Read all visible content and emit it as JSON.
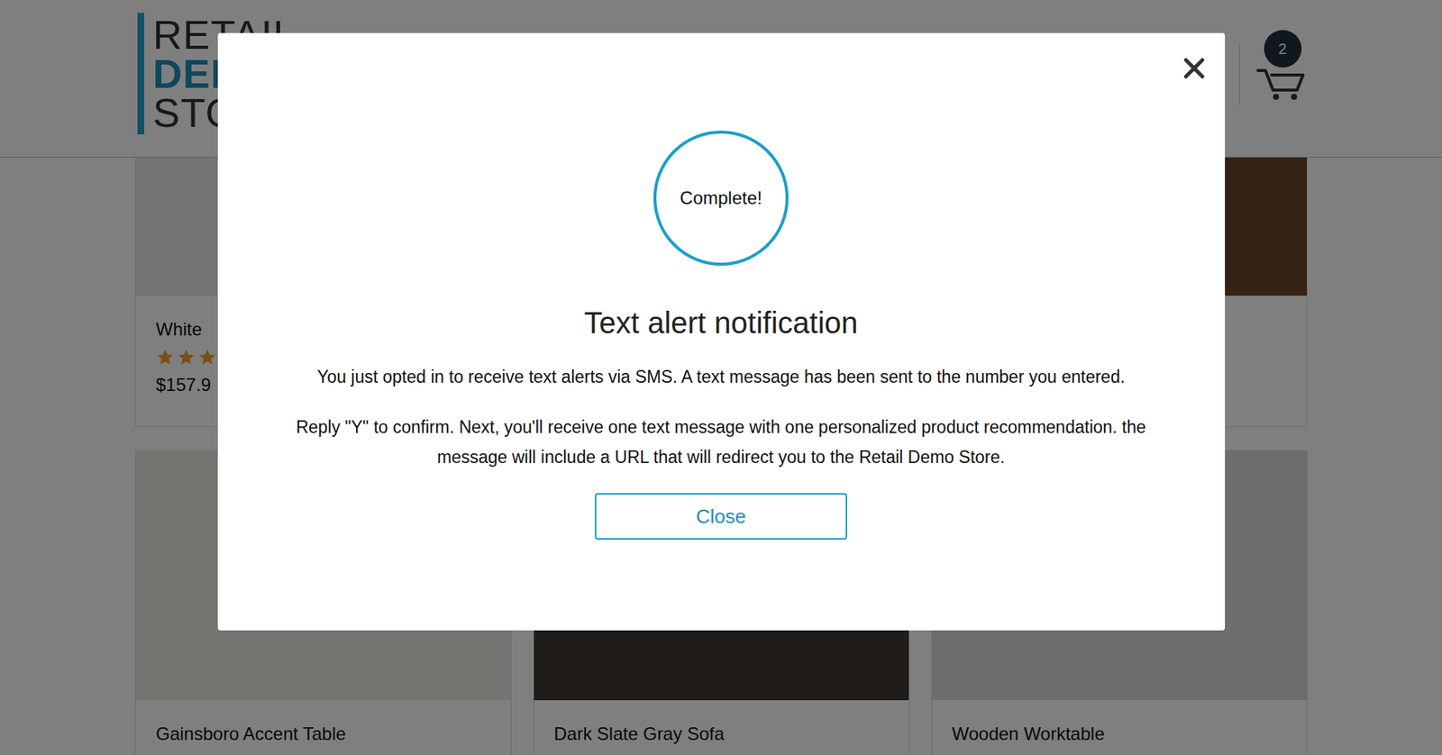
{
  "header": {
    "logo_lines": [
      {
        "text": "RETAIL",
        "bold": false
      },
      {
        "text": "DEM",
        "bold": true
      },
      {
        "text": "STO",
        "bold": false
      }
    ],
    "cart_count": "2"
  },
  "top_row": [
    {
      "name": "White",
      "stars": 3,
      "price": "$157.9",
      "color": "#ece9e4"
    },
    {
      "color": "#d9d4cc"
    },
    {
      "color": "#6b4528"
    }
  ],
  "bottom_row": [
    {
      "name": "Gainsboro Accent Table",
      "color": "#ebe8e3"
    },
    {
      "name": "Dark Slate Gray Sofa",
      "color": "#3d3633"
    },
    {
      "name": "Wooden Worktable",
      "color": "#dcdad6"
    }
  ],
  "modal": {
    "status": "Complete!",
    "title": "Text alert notification",
    "paragraphs": [
      "You just opted in to receive text alerts via SMS. A text message has been sent to the number you entered.",
      "Reply \"Y\" to confirm. Next, you'll receive one text message with one personalized product recommendation. the message will include a URL that will redirect you to the Retail Demo Store."
    ],
    "button": "Close"
  }
}
